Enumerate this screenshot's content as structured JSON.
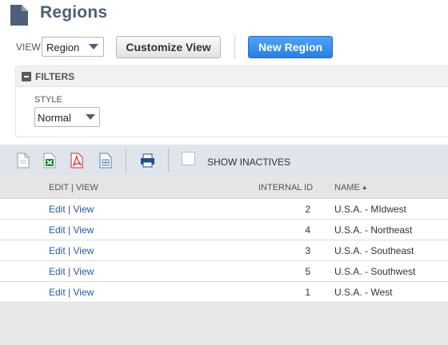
{
  "page": {
    "title": "Regions"
  },
  "view_row": {
    "view_label": "VIEW",
    "view_value": "Region",
    "customize_label": "Customize View",
    "new_label": "New Region"
  },
  "filters": {
    "title": "FILTERS",
    "style_label": "STYLE",
    "style_value": "Normal"
  },
  "toolbar": {
    "icons": [
      "document-export-icon",
      "excel-export-icon",
      "pdf-export-icon",
      "csv-export-icon",
      "print-icon"
    ],
    "show_inactives_label": "SHOW INACTIVES",
    "show_inactives_checked": false
  },
  "table": {
    "columns": {
      "edit_view": "EDIT | VIEW",
      "internal_id": "INTERNAL ID",
      "name": "NAME"
    },
    "sort_indicator": "▲",
    "rows": [
      {
        "edit": "Edit",
        "sep": "|",
        "view": "View",
        "internal_id": "2",
        "name": "U.S.A. - MIdwest"
      },
      {
        "edit": "Edit",
        "sep": "|",
        "view": "View",
        "internal_id": "4",
        "name": "U.S.A. - Northeast"
      },
      {
        "edit": "Edit",
        "sep": "|",
        "view": "View",
        "internal_id": "3",
        "name": "U.S.A. - Southeast"
      },
      {
        "edit": "Edit",
        "sep": "|",
        "view": "View",
        "internal_id": "5",
        "name": "U.S.A. - Southwest"
      },
      {
        "edit": "Edit",
        "sep": "|",
        "view": "View",
        "internal_id": "1",
        "name": "U.S.A. - West"
      }
    ]
  },
  "colors": {
    "title": "#4d5f79",
    "primary_button": "#2a7ee6",
    "link": "#255ba8",
    "toolbar_bg": "#dfe4ed"
  }
}
